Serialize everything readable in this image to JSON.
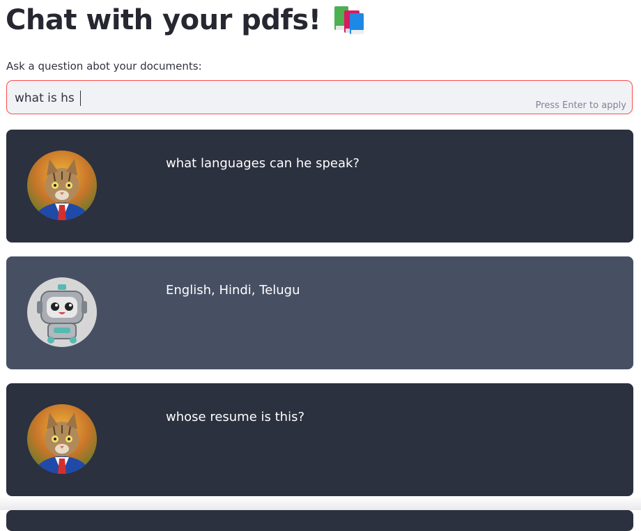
{
  "page": {
    "title": "Chat with your pdfs!",
    "title_icon": "books-icon"
  },
  "question_input": {
    "label": "Ask a question abot your documents:",
    "value": "what is hs",
    "hint": "Press Enter to apply"
  },
  "messages": [
    {
      "role": "user",
      "avatar": "cat-avatar",
      "text": "what languages can he speak?"
    },
    {
      "role": "bot",
      "avatar": "robot-avatar",
      "text": "English, Hindi, Telugu"
    },
    {
      "role": "user",
      "avatar": "cat-avatar",
      "text": "whose resume is this?"
    }
  ],
  "colors": {
    "user_bubble": "#2b313e",
    "bot_bubble": "#475063",
    "input_border_focus": "#ff4b4b",
    "input_bg": "#f0f2f6"
  }
}
